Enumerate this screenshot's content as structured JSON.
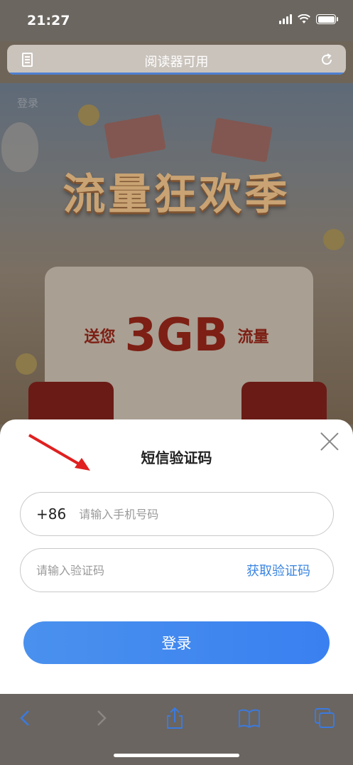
{
  "status_bar": {
    "time": "21:27"
  },
  "address_bar": {
    "text": "阅读器可用"
  },
  "web": {
    "login_link": "登录",
    "banner_title": "流量狂欢季",
    "card_prefix": "送您",
    "card_amount": "3GB",
    "card_suffix": "流量"
  },
  "sheet": {
    "title": "短信验证码",
    "country_code": "+86",
    "phone_placeholder": "请输入手机号码",
    "code_placeholder": "请输入验证码",
    "get_code_label": "获取验证码",
    "login_label": "登录"
  },
  "colors": {
    "accent": "#3a85e0",
    "button": "#4a91ee",
    "annotation_arrow": "#e02020"
  }
}
